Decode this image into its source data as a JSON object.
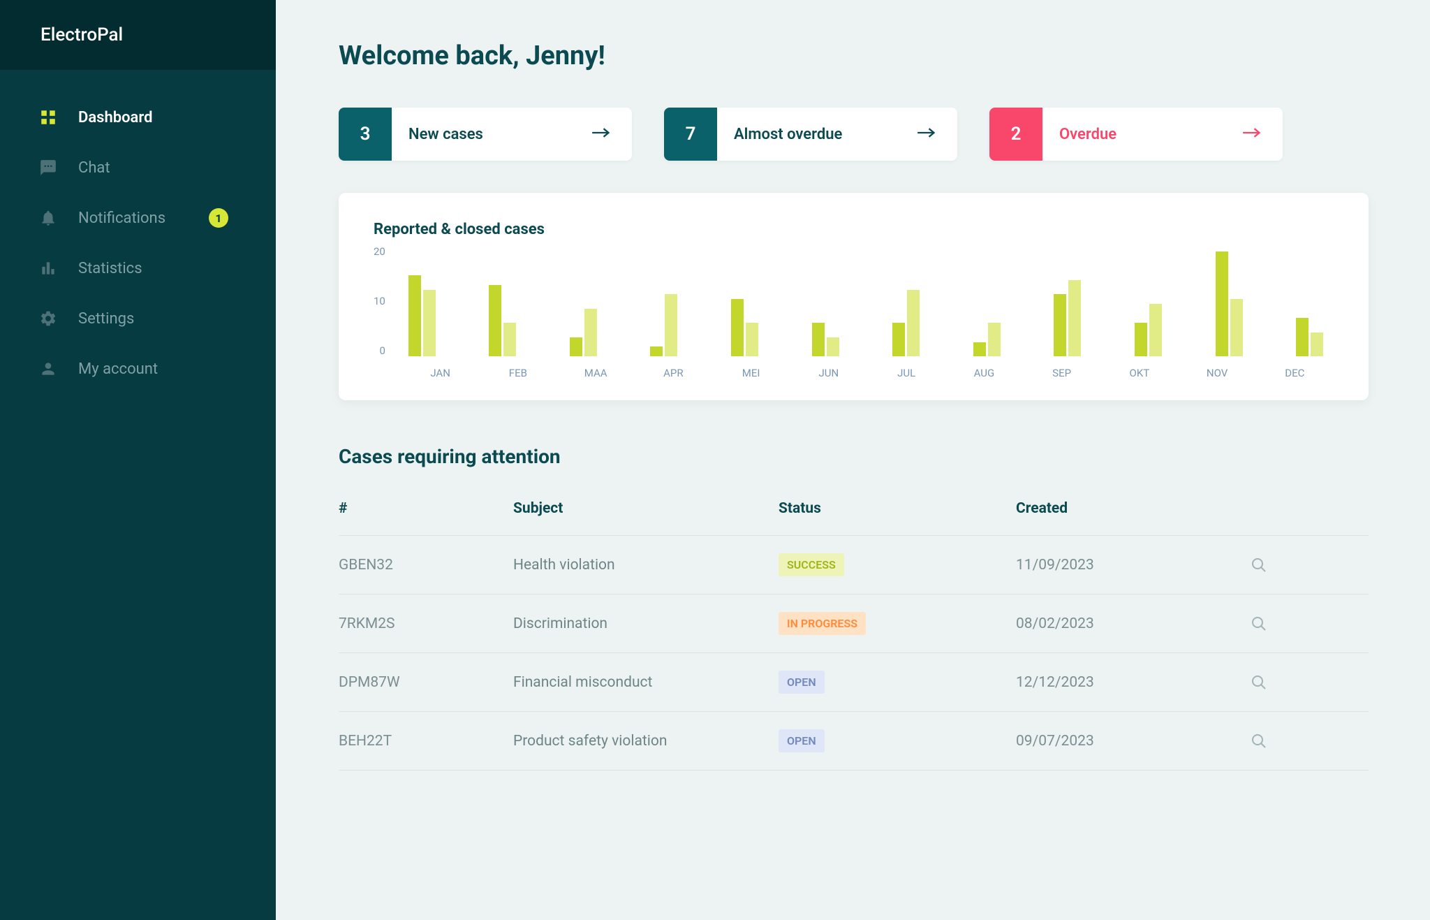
{
  "app_name": "ElectroPal",
  "sidebar": {
    "items": [
      {
        "label": "Dashboard",
        "icon": "grid"
      },
      {
        "label": "Chat",
        "icon": "chat"
      },
      {
        "label": "Notifications",
        "icon": "bell",
        "badge": "1"
      },
      {
        "label": "Statistics",
        "icon": "stats"
      },
      {
        "label": "Settings",
        "icon": "gear"
      },
      {
        "label": "My account",
        "icon": "person"
      }
    ]
  },
  "welcome": "Welcome back, Jenny!",
  "cards": [
    {
      "count": "3",
      "label": "New cases"
    },
    {
      "count": "7",
      "label": "Almost overdue"
    },
    {
      "count": "2",
      "label": "Overdue"
    }
  ],
  "chart_title": "Reported & closed cases",
  "chart_data": {
    "type": "bar",
    "title": "Reported & closed cases",
    "categories": [
      "JAN",
      "FEB",
      "MAA",
      "APR",
      "MEI",
      "JUN",
      "JUL",
      "AUG",
      "SEP",
      "OKT",
      "NOV",
      "DEC"
    ],
    "series": [
      {
        "name": "Reported",
        "values": [
          17,
          15,
          4,
          2,
          12,
          7,
          7,
          3,
          13,
          7,
          22,
          8
        ]
      },
      {
        "name": "Closed",
        "values": [
          14,
          7,
          10,
          13,
          7,
          4,
          14,
          7,
          16,
          11,
          12,
          5
        ]
      }
    ],
    "ylim": [
      0,
      22
    ],
    "yticks": [
      20,
      10,
      0
    ],
    "xlabel": "",
    "ylabel": ""
  },
  "table": {
    "title": "Cases requiring attention",
    "headers": {
      "id": "#",
      "subject": "Subject",
      "status": "Status",
      "created": "Created"
    },
    "rows": [
      {
        "id": "GBEN32",
        "subject": "Health violation",
        "status": "SUCCESS",
        "status_kind": "success",
        "created": "11/09/2023"
      },
      {
        "id": "7RKM2S",
        "subject": "Discrimination",
        "status": "IN PROGRESS",
        "status_kind": "inprogress",
        "created": "08/02/2023"
      },
      {
        "id": "DPM87W",
        "subject": "Financial misconduct",
        "status": "OPEN",
        "status_kind": "open",
        "created": "12/12/2023"
      },
      {
        "id": "BEH22T",
        "subject": "Product safety violation",
        "status": "OPEN",
        "status_kind": "open",
        "created": "09/07/2023"
      }
    ]
  }
}
